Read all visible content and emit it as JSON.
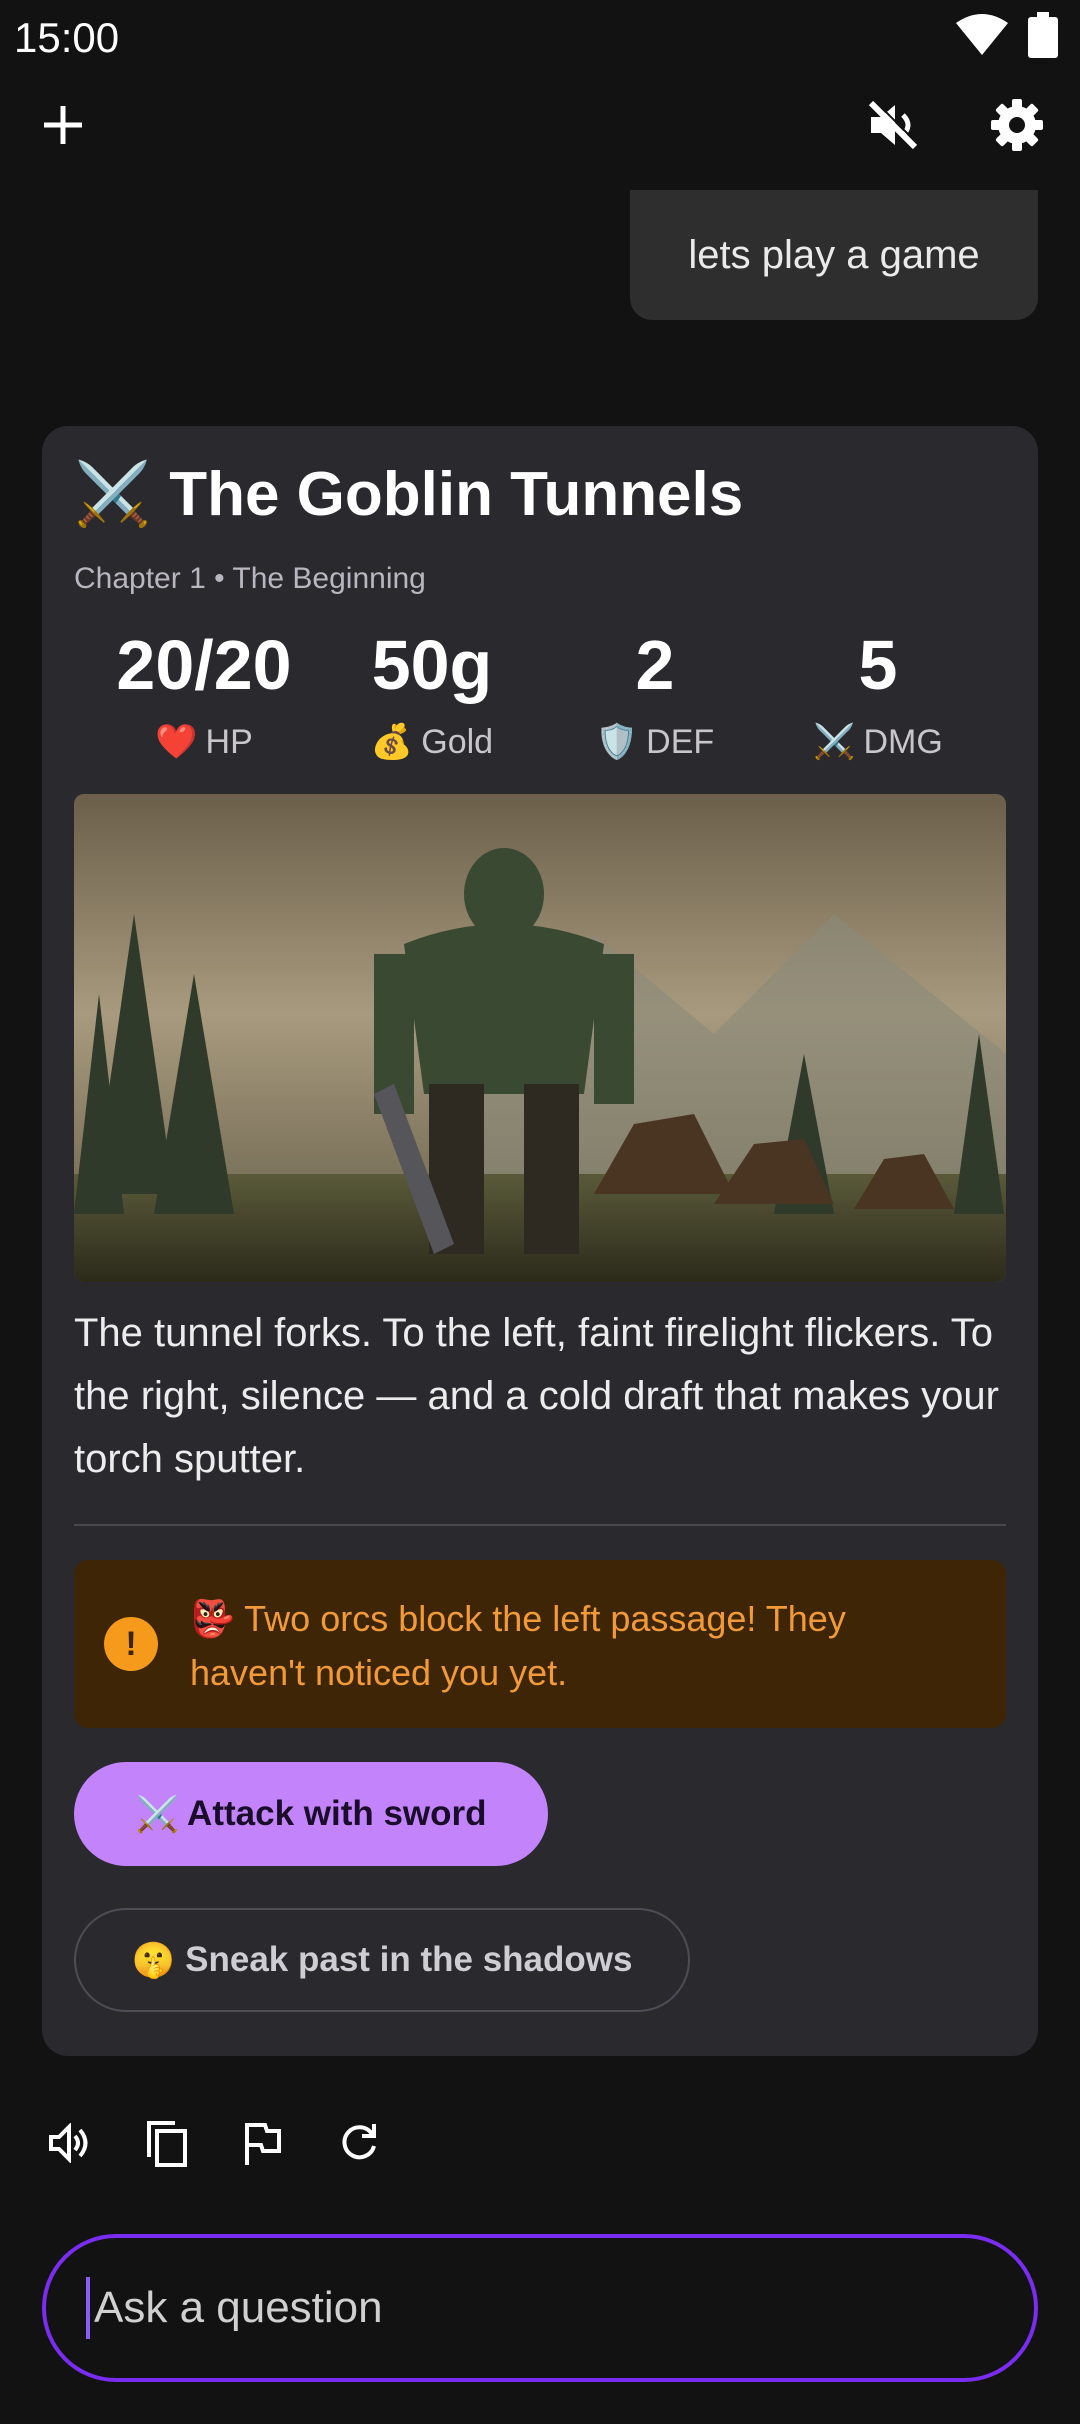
{
  "status_bar": {
    "time": "15:00"
  },
  "top_bar": {
    "new_icon": "plus-icon",
    "mute_icon": "volume-off-icon",
    "settings_icon": "gear-icon"
  },
  "chat": {
    "user_message": "lets play a game"
  },
  "game_card": {
    "title_emoji": "⚔️",
    "title": "The Goblin Tunnels",
    "chapter": "Chapter 1 • The Beginning",
    "stats": [
      {
        "value": "20/20",
        "emoji": "❤️",
        "label": "HP"
      },
      {
        "value": "50g",
        "emoji": "💰",
        "label": "Gold"
      },
      {
        "value": "2",
        "emoji": "🛡️",
        "label": "DEF"
      },
      {
        "value": "5",
        "emoji": "⚔️",
        "label": "DMG"
      }
    ],
    "narrative": "The tunnel forks. To the left, faint firelight flickers. To the right, silence — and a cold draft that makes your torch sputter.",
    "alert": {
      "icon": "!",
      "text": "👺 Two orcs block the left passage! They haven't noticed you yet."
    },
    "choices": [
      {
        "emoji": "⚔️",
        "label": "Attack with sword"
      },
      {
        "emoji": "🤫",
        "label": "Sneak past in the shadows"
      }
    ]
  },
  "message_actions": [
    "speaker-icon",
    "copy-icon",
    "flag-icon",
    "refresh-icon"
  ],
  "input": {
    "placeholder": "Ask a question"
  },
  "colors": {
    "accent": "#c384fb",
    "alert_bg": "#3d2505",
    "alert_text": "#f29a38",
    "input_border": "#7a2cf0"
  }
}
